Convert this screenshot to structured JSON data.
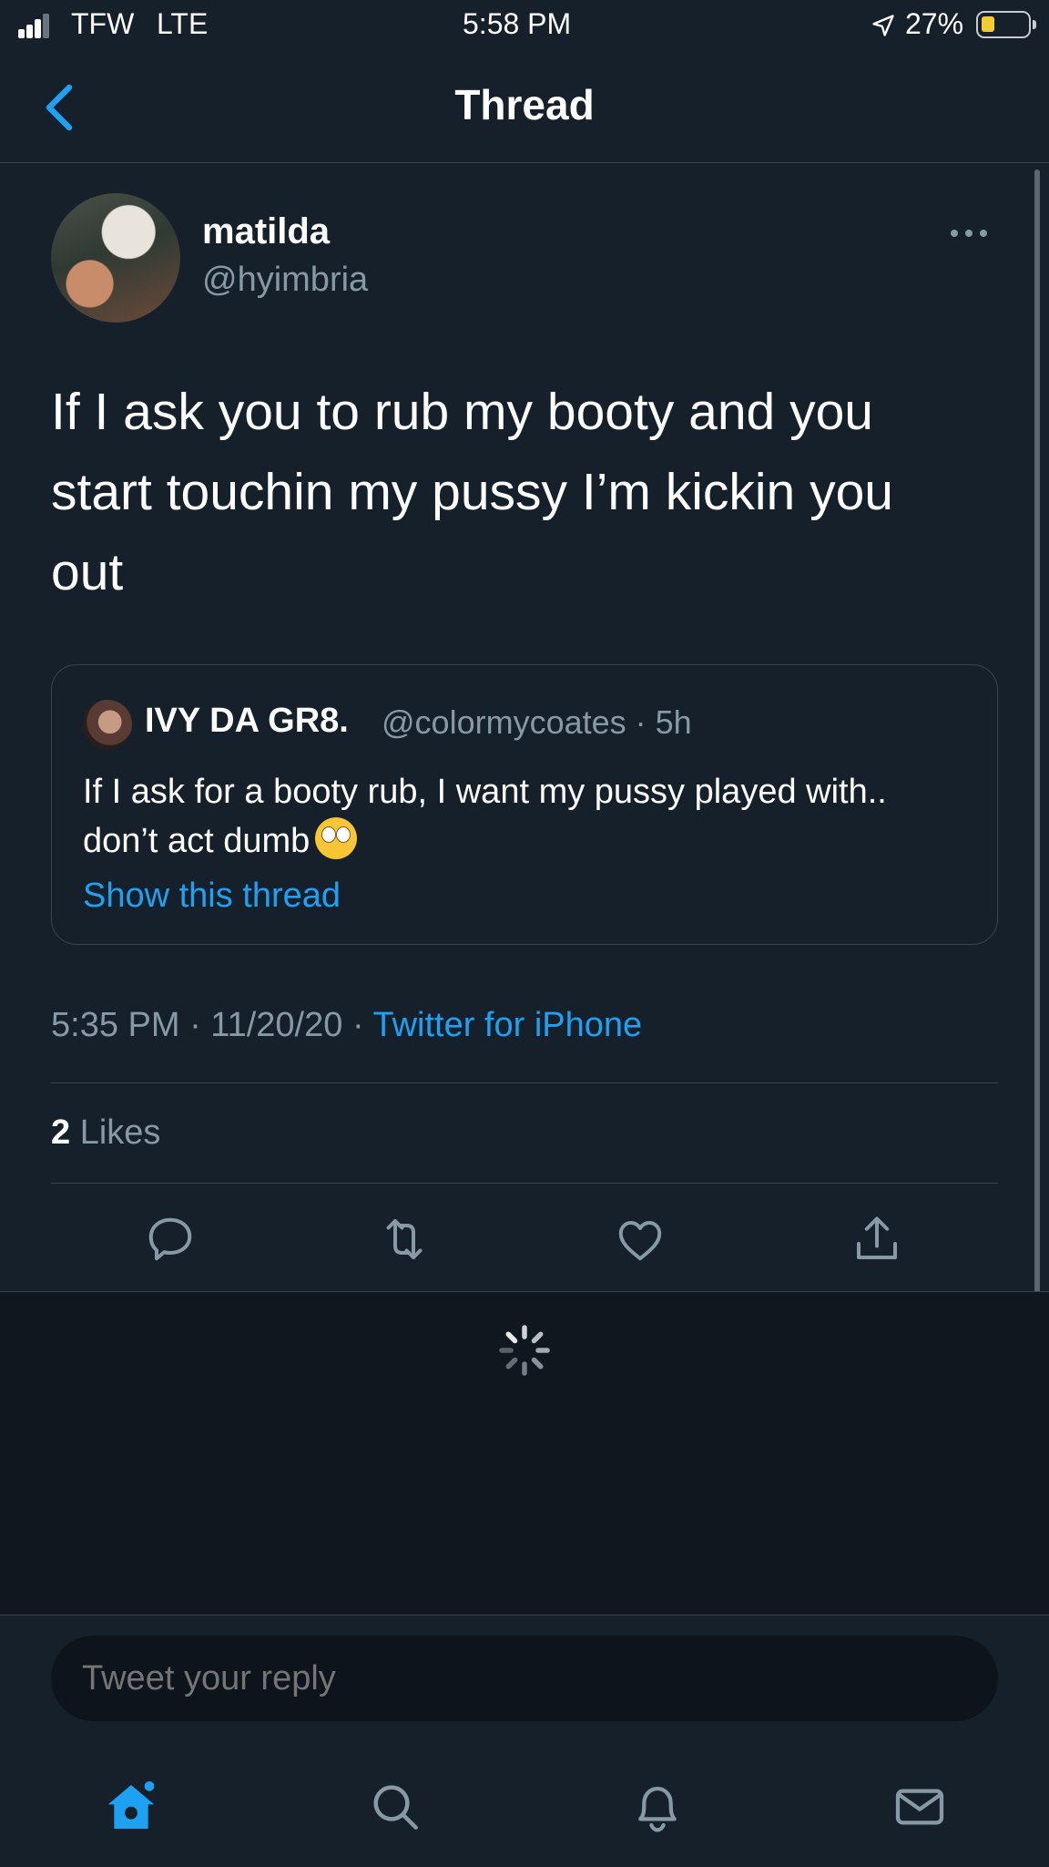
{
  "status_bar": {
    "carrier": "TFW",
    "network": "LTE",
    "time": "5:58 PM",
    "battery": "27%",
    "battery_level": 0.27
  },
  "nav": {
    "title": "Thread",
    "back_icon": "chevron-left-icon"
  },
  "tweet": {
    "author_name": "matilda",
    "author_handle": "@hyimbria",
    "text": "If I ask you to rub my booty and you start touchin my pussy I’m kickin you out",
    "quoted": {
      "author_name": "IVY DA GR8.",
      "author_handle": "@colormycoates · 5h",
      "text": "If I ask for a booty rub, I want my pussy played with.. don’t act dumb",
      "emoji": "face-with-rolling-eyes-icon",
      "show_thread_label": "Show this thread"
    },
    "timestamp": "5:35 PM · 11/20/20 · ",
    "source": "Twitter for iPhone",
    "likes_count": "2",
    "likes_label": "Likes"
  },
  "actions": [
    "reply-icon",
    "retweet-icon",
    "like-icon",
    "share-icon"
  ],
  "reply": {
    "placeholder": "Tweet your reply"
  },
  "tab_bar": [
    "home-icon",
    "search-icon",
    "notifications-icon",
    "messages-icon"
  ],
  "colors": {
    "background": "#15202b",
    "accent": "#1da1f2",
    "muted_text": "#8899a6",
    "divider": "#38444d"
  }
}
